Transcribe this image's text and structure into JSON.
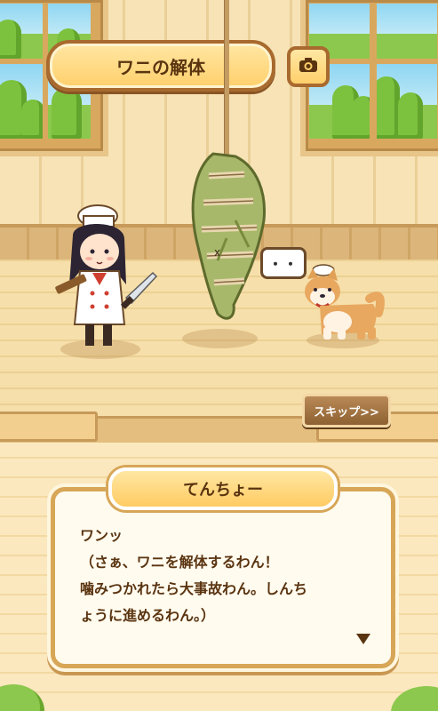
{
  "title": "ワニの解体",
  "camera_icon": "camera-icon",
  "bubble_text": "・・",
  "skip_label": "スキップ>>",
  "dialog": {
    "speaker": "てんちょー",
    "lines": [
      "ワンッ",
      "（さぁ、ワニを解体するわん！",
      "噛みつかれたら大事故わん。しんち",
      "ょうに進めるわん。）"
    ],
    "next_icon": "triangle-down-icon"
  },
  "colors": {
    "accent": "#ffcf6b",
    "text": "#5a3410",
    "frame": "#a86a2e"
  }
}
